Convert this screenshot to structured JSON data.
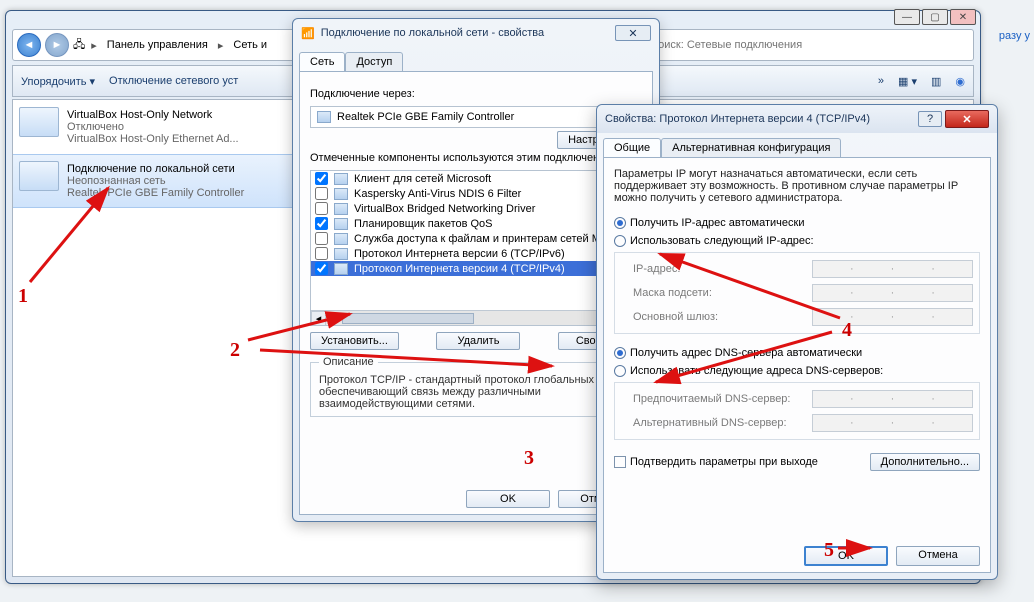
{
  "explorer": {
    "breadcrumb": {
      "root": "Панель управления",
      "next": "Сеть и"
    },
    "search_placeholder": "Поиск: Сетевые подключения",
    "cmd": {
      "organize": "Упорядочить ▾",
      "disable": "Отключение сетевого уст",
      "more": "»"
    },
    "items": [
      {
        "title": "VirtualBox Host-Only Network",
        "status": "Отключено",
        "adapter": "VirtualBox Host-Only Ethernet Ad..."
      },
      {
        "title": "Подключение по локальной сети",
        "status": "Неопознанная сеть",
        "adapter": "Realtek PCIe GBE Family Controller"
      }
    ]
  },
  "prop": {
    "title": "Подключение по локальной сети - свойства",
    "tabs": {
      "net": "Сеть",
      "access": "Доступ"
    },
    "connect_via": "Подключение через:",
    "adapter": "Realtek PCIe GBE Family Controller",
    "configure": "Настроить...",
    "comp_intro": "Отмеченные компоненты используются этим подключением:",
    "comps": [
      {
        "chk": true,
        "label": "Клиент для сетей Microsoft"
      },
      {
        "chk": false,
        "label": "Kaspersky Anti-Virus NDIS 6 Filter"
      },
      {
        "chk": false,
        "label": "VirtualBox Bridged Networking Driver"
      },
      {
        "chk": true,
        "label": "Планировщик пакетов QoS"
      },
      {
        "chk": false,
        "label": "Служба доступа к файлам и принтерам сетей Microsoft"
      },
      {
        "chk": false,
        "label": "Протокол Интернета версии 6 (TCP/IPv6)"
      },
      {
        "chk": true,
        "label": "Протокол Интернета версии 4 (TCP/IPv4)",
        "sel": true
      }
    ],
    "install": "Установить...",
    "remove": "Удалить",
    "props": "Свойства",
    "desc_h": "Описание",
    "desc": "Протокол TCP/IP - стандартный протокол глобальных сетей, обеспечивающий связь между различными взаимодействующими сетями.",
    "ok": "OK",
    "cancel": "Отмена"
  },
  "ip": {
    "title": "Свойства: Протокол Интернета версии 4 (TCP/IPv4)",
    "tabs": {
      "gen": "Общие",
      "alt": "Альтернативная конфигурация"
    },
    "intro": "Параметры IP могут назначаться автоматически, если сеть поддерживает эту возможность. В противном случае параметры IP можно получить у сетевого администратора.",
    "r_auto_ip": "Получить IP-адрес автоматически",
    "r_man_ip": "Использовать следующий IP-адрес:",
    "ip_addr": "IP-адрес:",
    "mask": "Маска подсети:",
    "gw": "Основной шлюз:",
    "r_auto_dns": "Получить адрес DNS-сервера автоматически",
    "r_man_dns": "Использовать следующие адреса DNS-серверов:",
    "dns1": "Предпочитаемый DNS-сервер:",
    "dns2": "Альтернативный DNS-сервер:",
    "validate": "Подтвердить параметры при выходе",
    "adv": "Дополнительно...",
    "ok": "OK",
    "cancel": "Отмена"
  },
  "ann": {
    "1": "1",
    "2": "2",
    "3": "3",
    "4": "4",
    "5": "5"
  },
  "extra": {
    "text": "разу у"
  }
}
